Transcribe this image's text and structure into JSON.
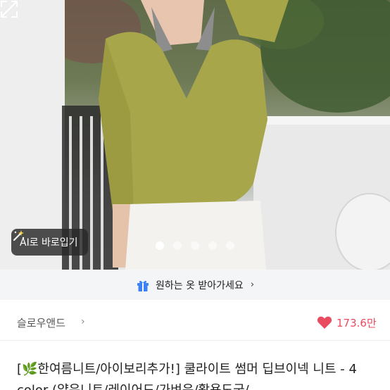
{
  "gallery": {
    "ai_button_label": "AI로 바로입기",
    "slide_count": 5,
    "active_slide": 1
  },
  "banner": {
    "text": "원하는 옷 받아가세요",
    "chevron": "›"
  },
  "seller": {
    "store_name": "슬로우앤드",
    "store_chevron": "›",
    "likes": "173.6만"
  },
  "product": {
    "title": "[🌿한여름니트/아이보리추가!] 쿨라이트 썸머 딥브이넥 니트 - 4 color (얇은니트/레이어드/가벼운/활용도굳/"
  },
  "colors": {
    "accent_red": "#e94b5f",
    "banner_bg": "#f4f5f7",
    "gift_blue": "#3b82f6"
  }
}
